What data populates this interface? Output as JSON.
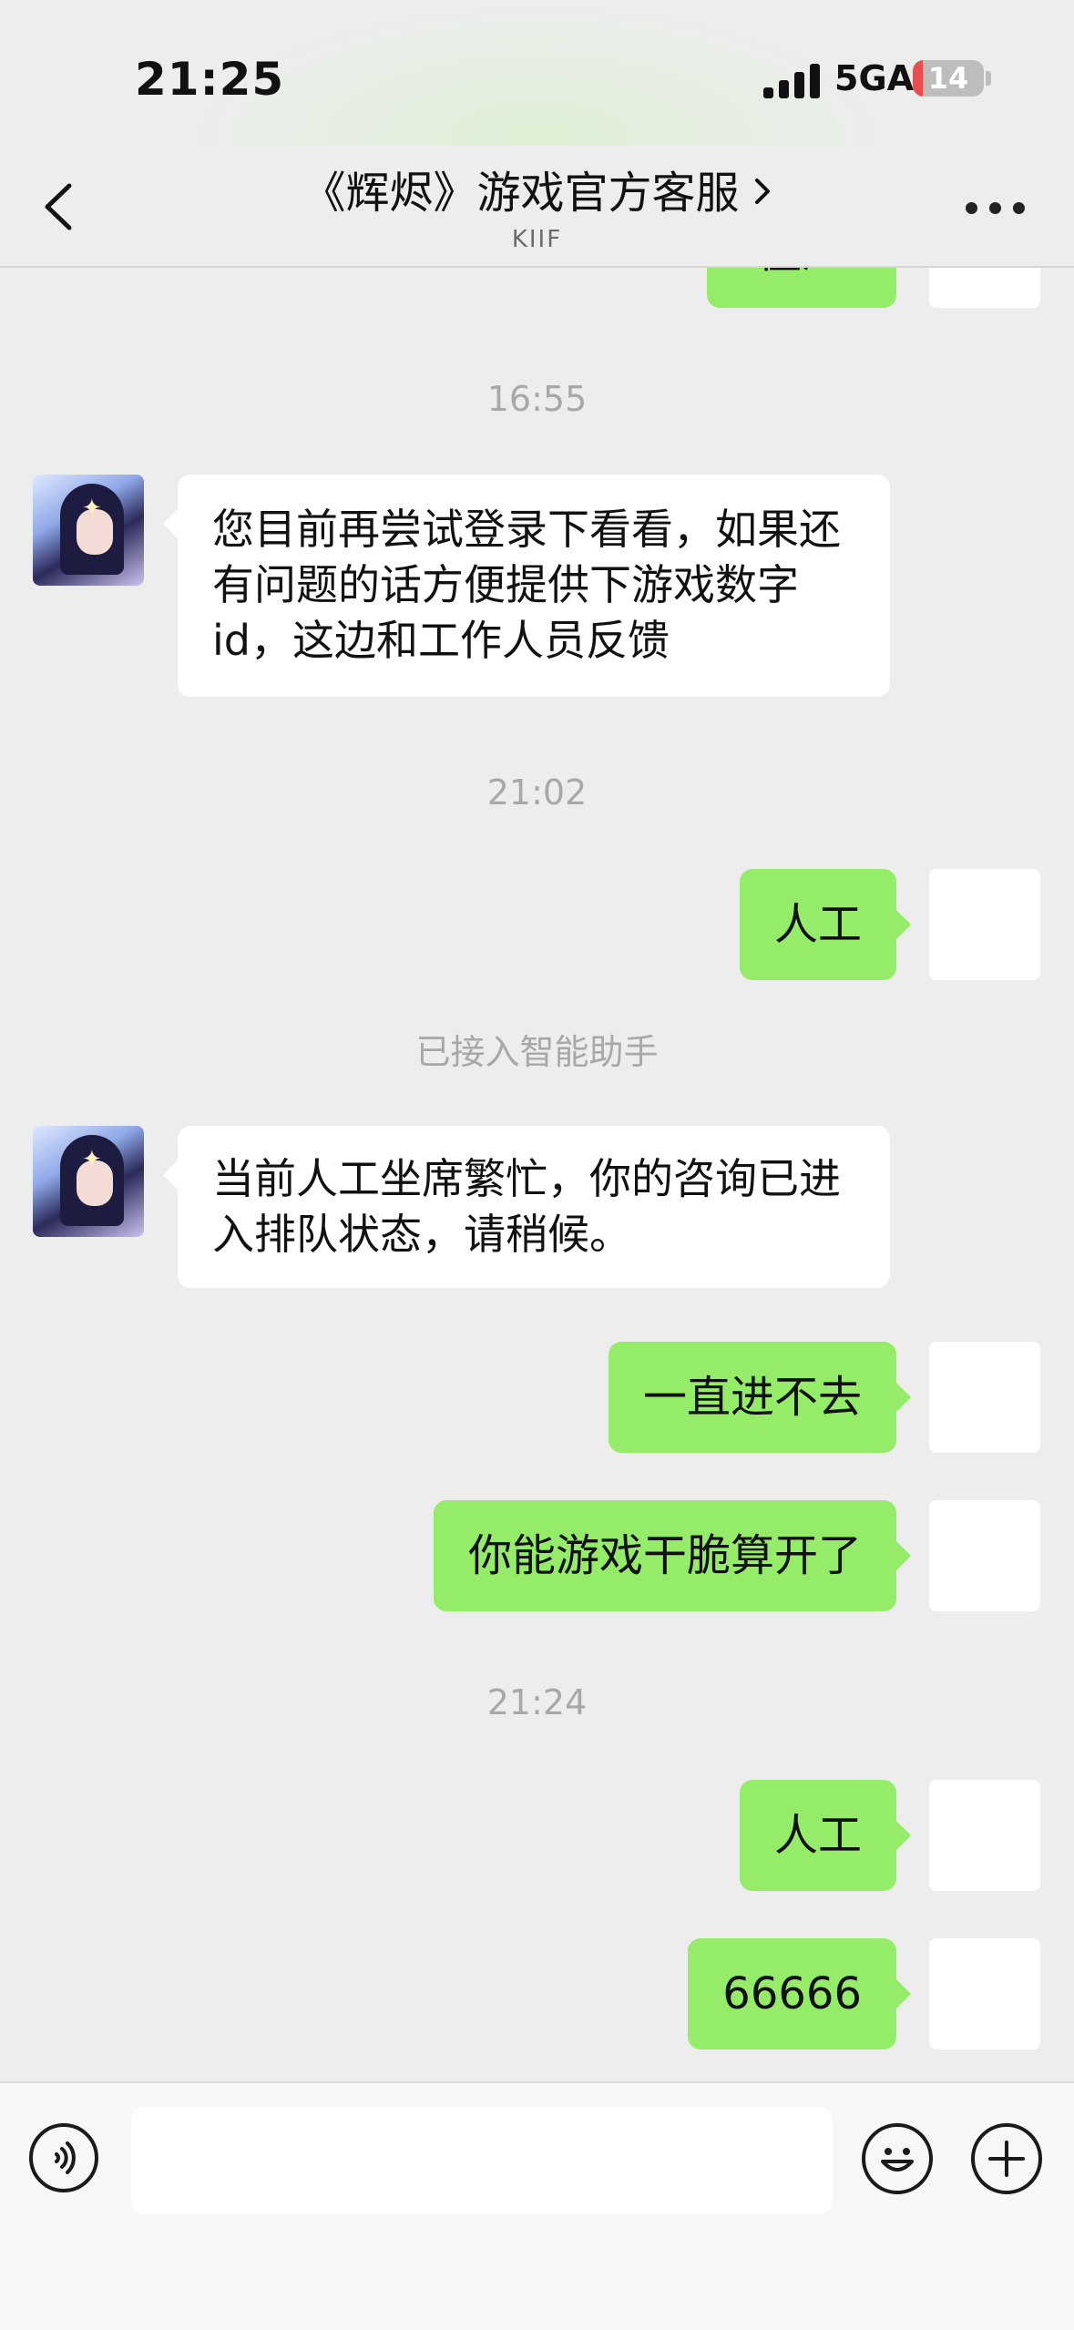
{
  "status_bar": {
    "time": "21:25",
    "network": "5GA",
    "battery_percent": "14",
    "battery_level": 0.14,
    "battery_color": "#ea4d4d"
  },
  "nav": {
    "back_icon": "chevron-left-icon",
    "title": "《辉烬》游戏官方客服",
    "title_chevron_icon": "chevron-right-icon",
    "subtitle": "KIIF",
    "more_icon": "more-dots-icon"
  },
  "chat": {
    "partial_out_text": "僵尸",
    "ts1": "16:55",
    "msg1": "您目前再尝试登录下看看，如果还有问题的话方便提供下游戏数字id，这边和工作人员反馈",
    "ts2": "21:02",
    "msg2": "人工",
    "system_notice": "已接入智能助手",
    "msg3": "当前人工坐席繁忙，你的咨询已进入排队状态，请稍候。",
    "msg4": "一直进不去",
    "msg5": "你能游戏干脆算开了",
    "ts3": "21:24",
    "msg6": "人工",
    "msg7": "66666"
  },
  "input_bar": {
    "voice_icon": "voice-icon",
    "text_value": "",
    "emoji_icon": "emoji-icon",
    "plus_icon": "plus-icon"
  },
  "colors": {
    "background": "#ededed",
    "outgoing_bubble": "#95ec69",
    "incoming_bubble": "#ffffff",
    "timestamp": "#a8a8a8"
  }
}
